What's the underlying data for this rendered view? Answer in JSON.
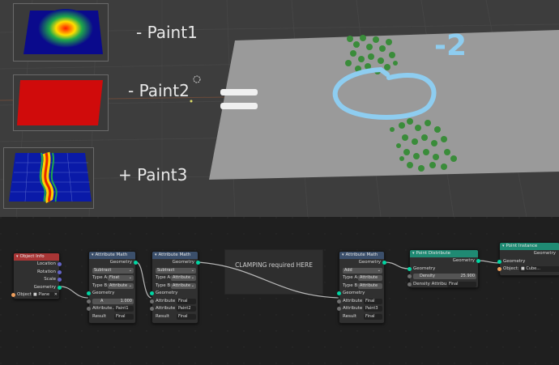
{
  "viewport": {
    "labels": [
      "- Paint1",
      "- Paint2",
      "+ Paint3"
    ],
    "equals": "=",
    "annotation": "-2"
  },
  "frame": {
    "label": "CLAMPING required HERE"
  },
  "nodes": {
    "object_info": {
      "title": "Object Info",
      "outputs": [
        "Location",
        "Rotation",
        "Scale",
        "Geometry"
      ],
      "object_label": "Object:",
      "object_value": "Plane",
      "close": "✕"
    },
    "math1": {
      "title": "Attribute Math",
      "output": "Geometry",
      "operation": "Subtract",
      "type_a_label": "Type A:",
      "type_a_value": "Float",
      "type_b_label": "Type B:",
      "type_b_value": "Attribute",
      "geometry": "Geometry",
      "a_label": "A",
      "a_value": "1.000",
      "attribute_label": "Attribute...",
      "attribute_value": "Paint1",
      "result_label": "Result",
      "result_value": "Final"
    },
    "math2": {
      "title": "Attribute Math",
      "output": "Geometry",
      "operation": "Subtract",
      "type_a_label": "Type A:",
      "type_a_value": "Attribute",
      "type_b_label": "Type B:",
      "type_b_value": "Attribute",
      "geometry": "Geometry",
      "attr_a_label": "Attribute",
      "attr_a_value": "Final",
      "attr_b_label": "Attribute",
      "attr_b_value": "Paint2",
      "result_label": "Result",
      "result_value": "Final"
    },
    "math3": {
      "title": "Attribute Math",
      "output": "Geometry",
      "operation": "Add",
      "type_a_label": "Type A:",
      "type_a_value": "Attribute",
      "type_b_label": "Type B:",
      "type_b_value": "Attribute",
      "geometry": "Geometry",
      "attr_a_label": "Attribute",
      "attr_a_value": "Final",
      "attr_b_label": "Attribute",
      "attr_b_value": "Paint3",
      "result_label": "Result",
      "result_value": "Final"
    },
    "distribute": {
      "title": "Point Distribute",
      "output": "Geometry",
      "geometry": "Geometry",
      "density_label": "Density",
      "density_value": "25.900",
      "density_attr_label": "Density Attribu...",
      "density_attr_value": "Final"
    },
    "instance": {
      "title": "Point Instance",
      "output": "Geometry",
      "geometry": "Geometry",
      "object_label": "Object:",
      "object_value": "Cube..."
    }
  },
  "colors": {
    "geometry_socket": "#00d6a3",
    "object_info_header": "#a83535",
    "attribute_header": "#3b4f6b",
    "distribute_header": "#1f8a73",
    "annotation": "#8ecdf0"
  }
}
